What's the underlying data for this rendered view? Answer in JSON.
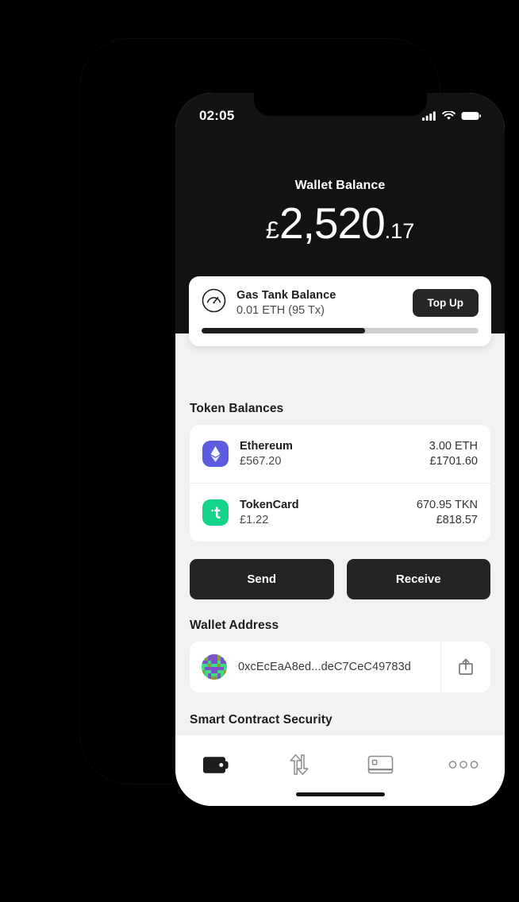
{
  "status_bar": {
    "time": "02:05",
    "icons": [
      "cellular-signal-icon",
      "wifi-icon",
      "battery-icon"
    ]
  },
  "header": {
    "balance_label": "Wallet Balance",
    "currency_symbol": "£",
    "balance_main": "2,520",
    "balance_cents": ".17"
  },
  "gas_card": {
    "icon": "gauge-icon",
    "title": "Gas Tank Balance",
    "subtitle": "0.01 ETH (95 Tx)",
    "top_up_label": "Top Up",
    "progress_percent": 59
  },
  "tokens": {
    "section_title": "Token Balances",
    "items": [
      {
        "name": "Ethereum",
        "price": "£567.20",
        "amount": "3.00 ETH",
        "fiat": "£1701.60",
        "icon": "ethereum-icon",
        "icon_color": "#5c5ce0",
        "glyph": "◆"
      },
      {
        "name": "TokenCard",
        "price": "£1.22",
        "amount": "670.95 TKN",
        "fiat": "£818.57",
        "icon": "tokencard-icon",
        "icon_color": "#14d48c",
        "glyph": "t"
      }
    ]
  },
  "actions": {
    "send_label": "Send",
    "receive_label": "Receive"
  },
  "wallet_address": {
    "section_title": "Wallet Address",
    "address": "0xcEcEaA8ed...deC7CeC49783d",
    "avatar": "blockie-avatar",
    "share_icon": "share-icon"
  },
  "security": {
    "section_title": "Smart Contract Security"
  },
  "bottom_nav": {
    "items": [
      {
        "name": "wallet",
        "icon": "wallet-icon",
        "active": true
      },
      {
        "name": "transfer",
        "icon": "transfer-arrows-icon",
        "active": false
      },
      {
        "name": "card",
        "icon": "card-icon",
        "active": false
      },
      {
        "name": "more",
        "icon": "more-dots-icon",
        "active": false
      }
    ]
  },
  "colors": {
    "header_bg": "#121212",
    "page_bg": "#f2f2f2",
    "button_dark": "#242424",
    "accent_green": "#14d48c",
    "accent_indigo": "#5c5ce0"
  }
}
